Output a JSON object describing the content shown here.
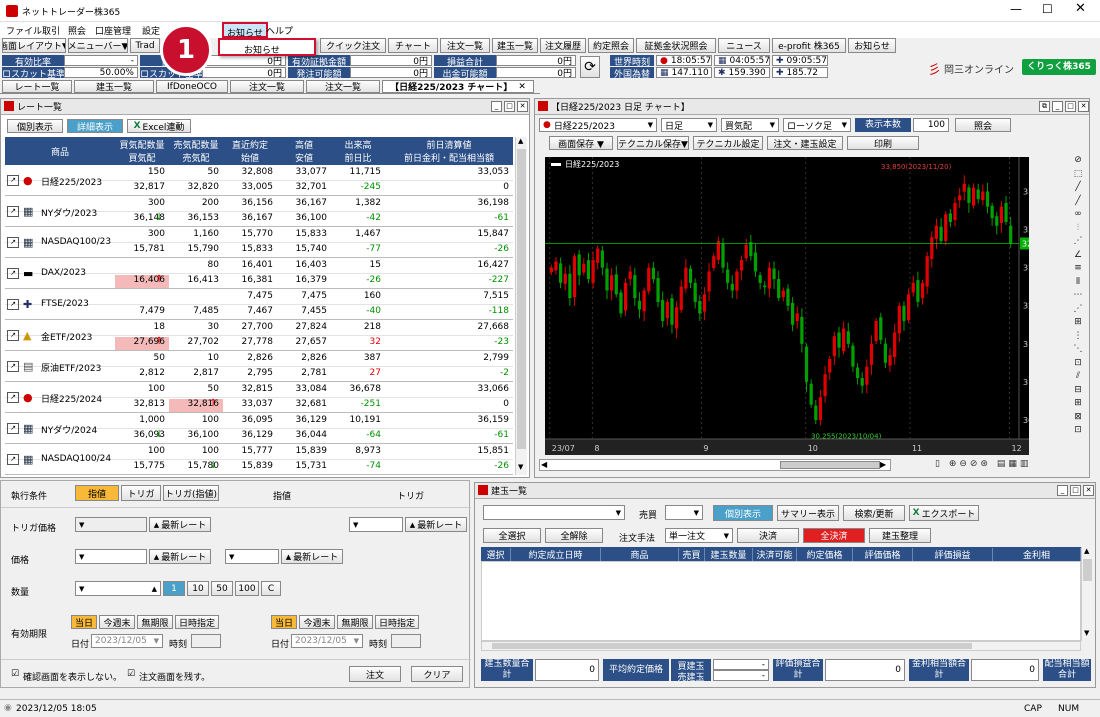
{
  "window": {
    "title": "ネットトレーダー株365"
  },
  "menu": [
    "ファイル",
    "取引",
    "照会",
    "口座管理",
    "設定",
    "お知らせ",
    "ヘルプ"
  ],
  "dropdown": {
    "item": "お知らせ"
  },
  "callout": {
    "number": "1"
  },
  "toolbar": {
    "layout": "画面レイアウト▼",
    "menu": "メニューバー▼",
    "trade": "Trad",
    "quick": "クイック注文",
    "chart": "チャート",
    "order_list": "注文一覧",
    "position_list": "建玉一覧",
    "order_history": "注文履歴",
    "contract": "約定照会",
    "margin": "証拠金状況照会",
    "news": "ニュース",
    "eprofit": "e-profit 株365",
    "notice": "お知らせ"
  },
  "account": {
    "r1": [
      {
        "label": "有効比率",
        "value": "-"
      },
      {
        "label": "証拠",
        "value": "0円"
      },
      {
        "label": "有効証拠金額",
        "value": "0円"
      },
      {
        "label": "損益合計",
        "value": "0円"
      }
    ],
    "r2": [
      {
        "label": "ロスカット基準",
        "value": "50.00%"
      },
      {
        "label": "ロスカット基準",
        "value": "0円"
      },
      {
        "label": "発注可能額",
        "value": "0円"
      },
      {
        "label": "出金可能額",
        "value": "0円"
      }
    ]
  },
  "world_time": {
    "label": "世界時刻",
    "fx_label": "外国為替",
    "times": [
      "18:05:57",
      "04:05:57",
      "09:05:57"
    ],
    "fx": [
      "147.110",
      "159.390",
      "185.72"
    ]
  },
  "brand": {
    "name": "岡三オンライン",
    "logo": "くりっく株365"
  },
  "tabs": [
    "レート一覧",
    "建玉一覧",
    "IfDoneOCO",
    "注文一覧",
    "注文一覧",
    "日経225/2023 チャート"
  ],
  "rate_panel": {
    "title": "レート一覧",
    "buttons": [
      "個別表示",
      "詳細表示",
      "Excel連動"
    ],
    "headers": {
      "product": "商品",
      "c1": [
        "買気配数量",
        "買気配"
      ],
      "c2": [
        "売気配数量",
        "売気配"
      ],
      "c3": [
        "直近約定",
        "始値"
      ],
      "c4": [
        "高値",
        "安値"
      ],
      "c5": [
        "出来高",
        "前日比"
      ],
      "c6": [
        "前日清算値",
        "前日金利・配当相当額"
      ]
    },
    "rows": [
      {
        "name": "日経225/2023",
        "flag": "jp",
        "top": [
          "150",
          "50",
          "32,808",
          "33,077",
          "11,715",
          "33,053"
        ],
        "bot": [
          "32,817",
          "32,820",
          "33,005",
          "32,701",
          "-245",
          "0"
        ],
        "arrow": ""
      },
      {
        "name": "NYダウ/2023",
        "flag": "us",
        "top": [
          "300",
          "200",
          "36,156",
          "36,167",
          "1,382",
          "36,198"
        ],
        "bot": [
          "36,148",
          "36,153",
          "36,167",
          "36,100",
          "-42",
          "-61"
        ],
        "arrow": "dn"
      },
      {
        "name": "NASDAQ100/23",
        "flag": "us",
        "top": [
          "300",
          "1,160",
          "15,770",
          "15,833",
          "1,467",
          "15,847"
        ],
        "bot": [
          "15,781",
          "15,790",
          "15,833",
          "15,740",
          "-77",
          "-26"
        ],
        "arrow": ""
      },
      {
        "name": "DAX/2023",
        "flag": "de",
        "top": [
          "",
          "80",
          "16,401",
          "16,403",
          "15",
          "16,427"
        ],
        "bot": [
          "16,406",
          "16,413",
          "16,381",
          "16,379",
          "-26",
          "-227"
        ],
        "arrow": "up"
      },
      {
        "name": "FTSE/2023",
        "flag": "uk",
        "top": [
          "",
          "",
          "7,475",
          "7,475",
          "160",
          "7,515"
        ],
        "bot": [
          "7,479",
          "7,485",
          "7,467",
          "7,455",
          "-40",
          "-118"
        ],
        "arrow": ""
      },
      {
        "name": "金ETF/2023",
        "flag": "gold",
        "top": [
          "18",
          "30",
          "27,700",
          "27,824",
          "218",
          "27,668"
        ],
        "bot": [
          "27,696",
          "27,702",
          "27,778",
          "27,657",
          "32",
          "-23"
        ],
        "arrow": "up"
      },
      {
        "name": "原油ETF/2023",
        "flag": "oil",
        "top": [
          "50",
          "10",
          "2,826",
          "2,826",
          "387",
          "2,799"
        ],
        "bot": [
          "2,812",
          "2,817",
          "2,795",
          "2,781",
          "27",
          "-2"
        ],
        "arrow": ""
      },
      {
        "name": "日経225/2024",
        "flag": "jp",
        "top": [
          "100",
          "50",
          "32,815",
          "33,084",
          "36,678",
          "33,066"
        ],
        "bot": [
          "32,813",
          "32,816",
          "33,037",
          "32,681",
          "-251",
          "0"
        ],
        "arrow": "up2"
      },
      {
        "name": "NYダウ/2024",
        "flag": "us",
        "top": [
          "1,000",
          "100",
          "36,095",
          "36,129",
          "10,191",
          "36,159"
        ],
        "bot": [
          "36,093",
          "36,100",
          "36,129",
          "36,044",
          "-64",
          "-61"
        ],
        "arrow": "dn"
      },
      {
        "name": "NASDAQ100/24",
        "flag": "us",
        "top": [
          "100",
          "100",
          "15,777",
          "15,839",
          "8,973",
          "15,851"
        ],
        "bot": [
          "15,775",
          "15,780",
          "15,839",
          "15,731",
          "-74",
          "-26"
        ],
        "arrow": "dn2"
      }
    ]
  },
  "chart_panel": {
    "title": "日経225/2023 日足 チャート",
    "product": "日経225/2023",
    "period": "日足",
    "side": "買気配",
    "type": "ローソク足",
    "count_label": "表示本数",
    "count": "100",
    "query": "照会",
    "btns": [
      "画面保存 ▼",
      "テクニカル保存▼",
      "テクニカル設定",
      "注文・建玉設定",
      "印刷"
    ]
  },
  "chart_data": {
    "type": "candlestick",
    "title": "日経225/2023",
    "y_ticks": [
      33500,
      33000,
      32500,
      32000,
      31500,
      31000,
      30500
    ],
    "x_ticks": [
      "23/07",
      "8",
      "9",
      "10",
      "11",
      "12"
    ],
    "ylim": [
      30250,
      33900
    ],
    "last_price": "32817",
    "annotations": [
      "33,850(2023/11/20)",
      "30,255(2023/10/04)"
    ],
    "closes": [
      32500,
      32580,
      32300,
      32420,
      32100,
      32650,
      32400,
      32550,
      32350,
      32600,
      32750,
      32500,
      32200,
      32400,
      32150,
      31900,
      32300,
      32450,
      32100,
      31950,
      32200,
      32500,
      32350,
      32050,
      31800,
      32050,
      31750,
      31980,
      32250,
      32500,
      32300,
      32050,
      31900,
      32150,
      32450,
      32650,
      32850,
      32500,
      32300,
      32200,
      32450,
      32600,
      32800,
      32650,
      32450,
      32300,
      32250,
      32500,
      32350,
      32100,
      32200,
      32000,
      31750,
      31900,
      31500,
      31000,
      30700,
      30500,
      30800,
      31100,
      31300,
      31600,
      31450,
      31700,
      31500,
      31200,
      31050,
      30950,
      31200,
      31500,
      31800,
      31550,
      31250,
      31350,
      31650,
      32000,
      31800,
      32150,
      32300,
      32050,
      32300,
      32650,
      32900,
      33050,
      32850,
      33200,
      33100,
      33350,
      33450,
      33600,
      33350,
      33550,
      33400,
      33500,
      33300,
      33150,
      33050,
      33300,
      33100,
      32817
    ]
  },
  "order_panel": {
    "exec_label": "執行条件",
    "exec_btns": [
      "指値",
      "トリガ",
      "トリガ(指値)"
    ],
    "col_limit": "指値",
    "col_trigger": "トリガ",
    "rows": [
      "トリガ価格",
      "価格",
      "数量",
      "有効期限"
    ],
    "latest": "最新レート",
    "qty_btns": [
      "1",
      "10",
      "50",
      "100",
      "C"
    ],
    "expiry": [
      "当日",
      "今週末",
      "無期限",
      "日時指定"
    ],
    "date_label": "日付",
    "date": "2023/12/05",
    "time_label": "時刻",
    "confirm": "確認画面を表示しない。",
    "keep": "注文画面を残す。",
    "order_btn": "注文",
    "clear_btn": "クリア"
  },
  "position_panel": {
    "title": "建玉一覧",
    "side_label": "売買",
    "btns": [
      "個別表示",
      "サマリー表示",
      "検索/更新",
      "エクスポート"
    ],
    "btns2": [
      "全選択",
      "全解除"
    ],
    "method_label": "注文手法",
    "method": "単一注文",
    "settle": "決済",
    "settle_all": "全決済",
    "arrange": "建玉整理",
    "headers": [
      "選択",
      "約定成立日時",
      "商品",
      "売買",
      "建玉数量",
      "決済可能",
      "約定価格",
      "評価価格",
      "評価損益",
      "金利相"
    ],
    "footer": {
      "qty_label": "建玉数量合計",
      "qty": "0",
      "avg_label": "平均約定価格",
      "buy": "買建玉",
      "sell": "売建玉",
      "dash": "-",
      "pl_label": "評価損益合計",
      "pl": "0",
      "int_label": "金利相当額合計",
      "int": "0",
      "div_label": "配当相当額合計"
    }
  },
  "status": {
    "datetime": "2023/12/05 18:05",
    "cap": "CAP",
    "num": "NUM"
  },
  "colors": {
    "hdr": "#2b4f86",
    "buy_red": "#f4b9b9",
    "chart_bg": "#000000",
    "up": "#e00000",
    "down": "#00a000"
  }
}
